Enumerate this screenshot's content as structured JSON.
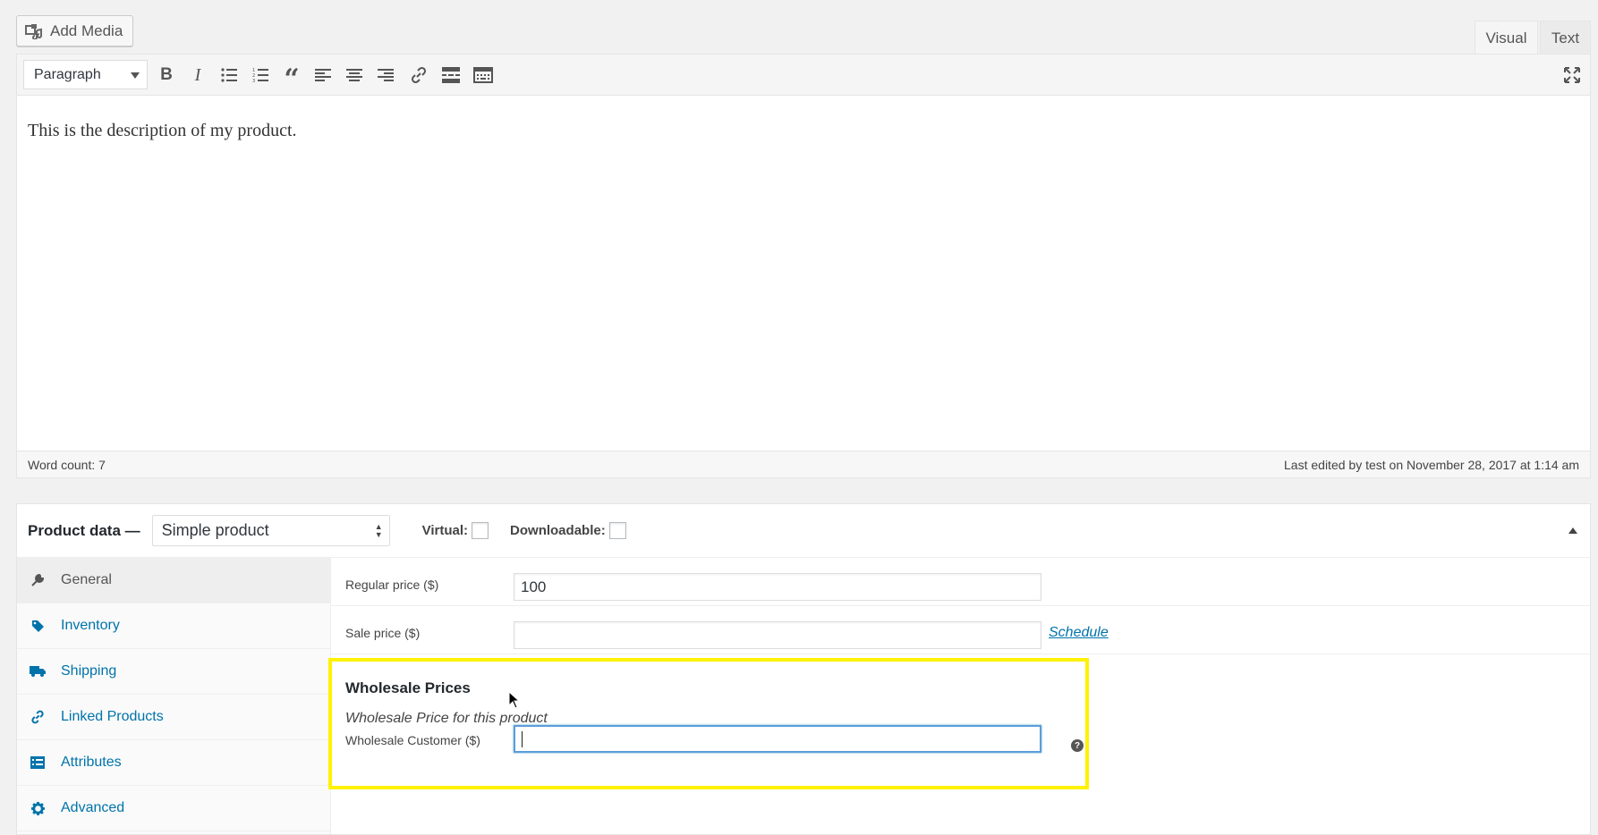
{
  "add_media": {
    "label": "Add Media"
  },
  "editor_tabs": {
    "visual": "Visual",
    "text": "Text"
  },
  "toolbar": {
    "format": "Paragraph",
    "buttons": [
      "bold-icon",
      "italic-icon",
      "bulleted-list-icon",
      "numbered-list-icon",
      "blockquote-icon",
      "align-left-icon",
      "align-center-icon",
      "align-right-icon",
      "link-icon",
      "read-more-icon",
      "toolbar-toggle-icon"
    ],
    "fullscreen_icon": "fullscreen-icon"
  },
  "editor": {
    "content": "This is the description of my product.",
    "word_count": "Word count: 7",
    "last_edited": "Last edited by test on November 28, 2017 at 1:14 am"
  },
  "product_data": {
    "title": "Product data —",
    "type": "Simple product",
    "virtual_label": "Virtual:",
    "downloadable_label": "Downloadable:",
    "virtual_checked": false,
    "downloadable_checked": false,
    "tabs": [
      {
        "label": "General",
        "icon": "wrench-icon",
        "active": true
      },
      {
        "label": "Inventory",
        "icon": "tag-icon",
        "active": false
      },
      {
        "label": "Shipping",
        "icon": "truck-icon",
        "active": false
      },
      {
        "label": "Linked Products",
        "icon": "link-icon",
        "active": false
      },
      {
        "label": "Attributes",
        "icon": "list-icon",
        "active": false
      },
      {
        "label": "Advanced",
        "icon": "gear-icon",
        "active": false
      }
    ],
    "general": {
      "regular_price_label": "Regular price ($)",
      "regular_price_value": "100",
      "sale_price_label": "Sale price ($)",
      "sale_price_value": "",
      "schedule_link": "Schedule",
      "wholesale_heading": "Wholesale Prices",
      "wholesale_desc": "Wholesale Price for this product",
      "wholesale_customer_label": "Wholesale Customer ($)",
      "wholesale_customer_value": "",
      "help_glyph": "?"
    }
  },
  "colors": {
    "link": "#0073aa",
    "highlight": "#fff200",
    "focus": "#5b9dd9"
  }
}
